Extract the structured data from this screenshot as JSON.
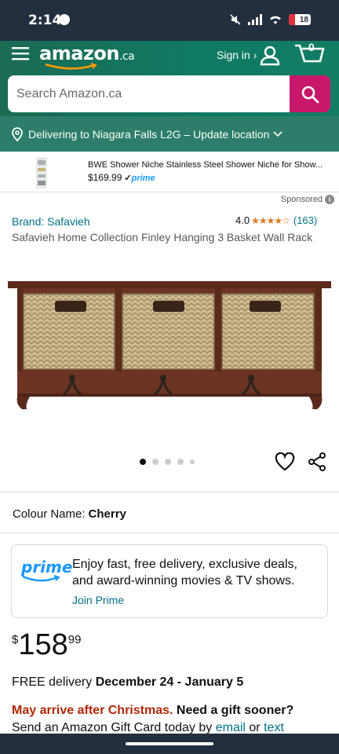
{
  "status_bar": {
    "time": "2:14",
    "battery": "18"
  },
  "header": {
    "logo_text": "amazon",
    "logo_tld": ".ca",
    "sign_in": "Sign in ›",
    "cart_count": "0",
    "accent_color": "#0f7a63"
  },
  "search": {
    "placeholder": "Search Amazon.ca",
    "button_color": "#c7176b"
  },
  "delivery_bar": {
    "text": "Delivering to Niagara Falls L2G – Update location"
  },
  "sponsored_ad": {
    "title": "BWE Shower Niche Stainless Steel Shower Niche for Show...",
    "price": "$169.99",
    "prime_badge": "prime",
    "sponsored_label": "Sponsored"
  },
  "product": {
    "brand": "Brand: Safavieh",
    "rating_value": "4.0",
    "rating_stars": 4,
    "rating_count": "(163)",
    "title": "Safavieh Home Collection Finley Hanging 3 Basket Wall Rack",
    "image_count": 4,
    "active_image": 1,
    "colour_label": "Colour Name:",
    "colour_value": "Cherry"
  },
  "prime_promo": {
    "logo": "prime",
    "text": "Enjoy fast, free delivery, exclusive deals, and award-winning movies & TV shows.",
    "link": "Join Prime"
  },
  "price": {
    "symbol": "$",
    "whole": "158",
    "fraction": "99"
  },
  "delivery": {
    "prefix": "FREE delivery",
    "dates": "December 24 - January 5"
  },
  "christmas": {
    "warning": "May arrive after Christmas.",
    "question": "Need a gift sooner?",
    "line2_prefix": "Send an Amazon Gift Card today by",
    "email_link": "email",
    "or": "or",
    "text_link": "text"
  }
}
